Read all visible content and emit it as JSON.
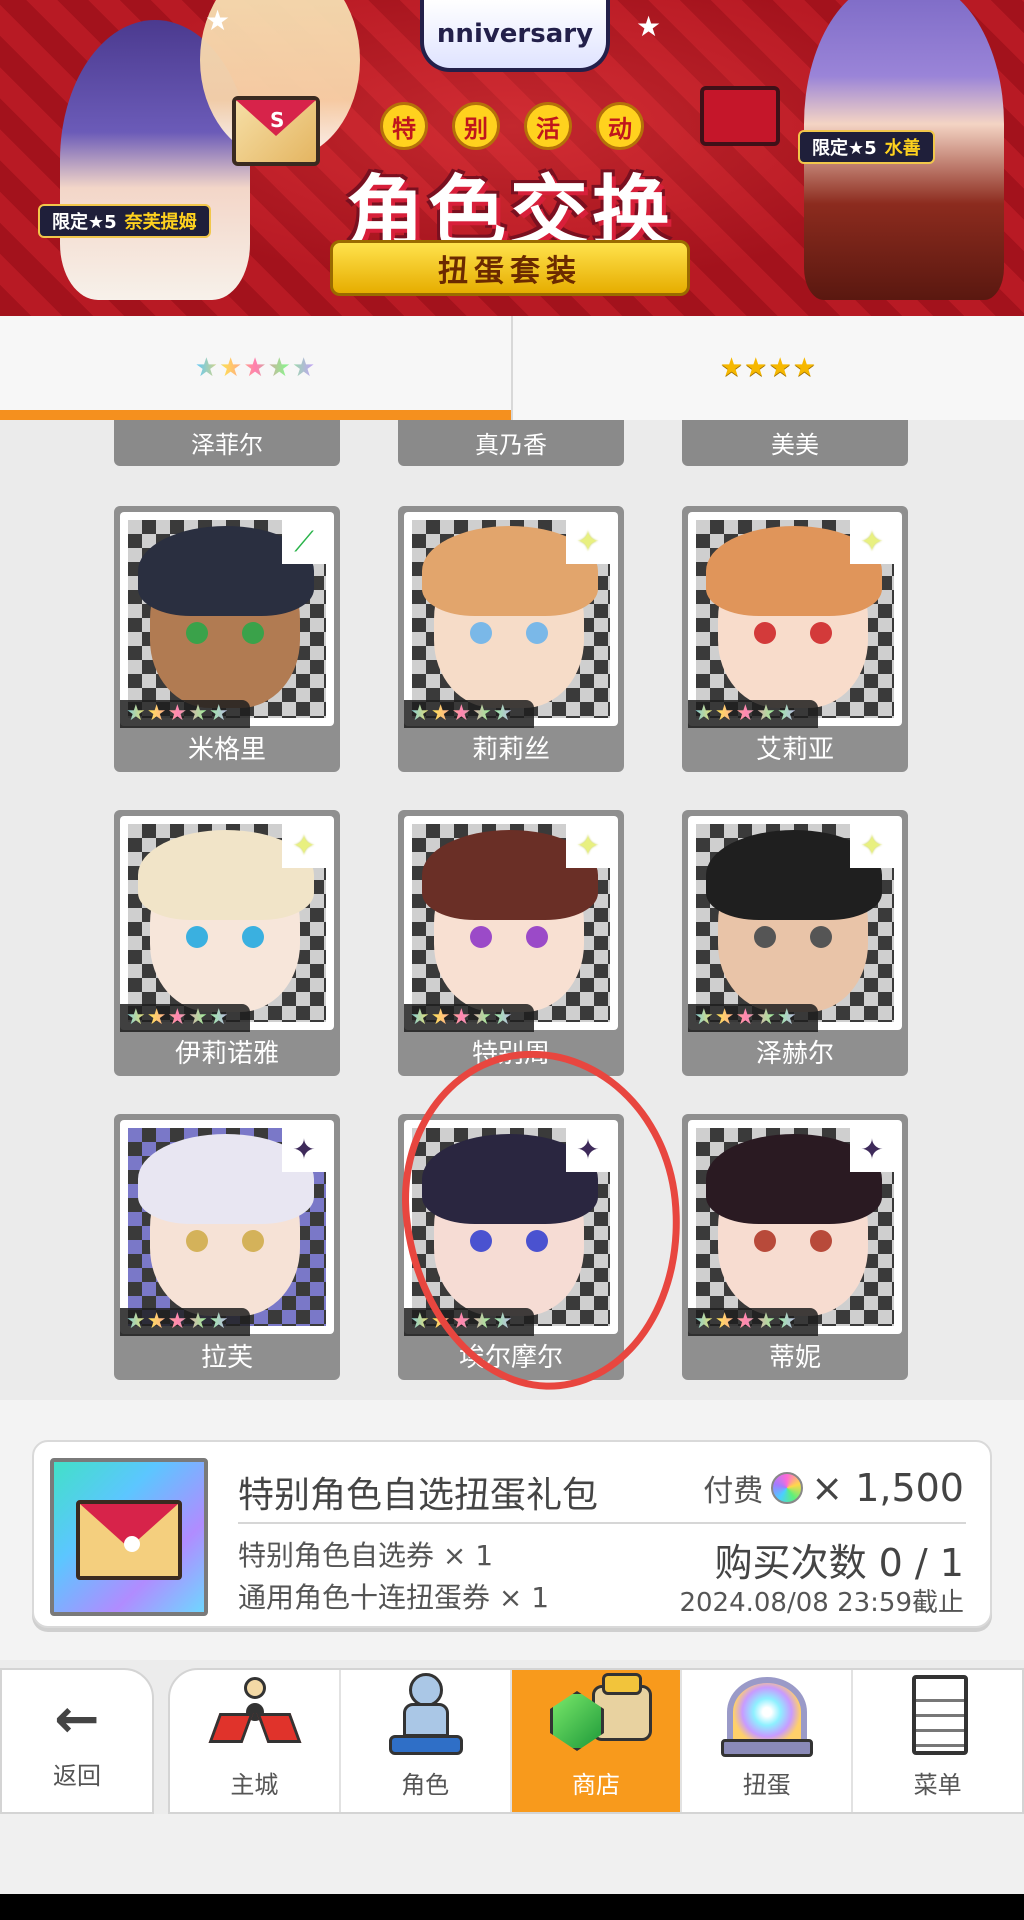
{
  "banner": {
    "logo_text": "nniversary",
    "event_chars": [
      "特",
      "别",
      "活",
      "动"
    ],
    "title": "角色交换",
    "subtitle": "扭蛋套装",
    "tag_left": {
      "prefix": "限定★5",
      "name": "奈芙提姆"
    },
    "tag_right": {
      "prefix": "限定★5",
      "name": "水善"
    }
  },
  "tabs": [
    {
      "label": "★★★★★",
      "active": true
    },
    {
      "label": "★★★★",
      "active": false
    }
  ],
  "partial_row": [
    "泽菲尔",
    "真乃香",
    "美美"
  ],
  "characters": [
    {
      "name": "米格里",
      "stars": "★★★★★",
      "corner": "green",
      "corner_glyph": "⟋"
    },
    {
      "name": "莉莉丝",
      "stars": "★★★★★",
      "corner": "sparkle",
      "corner_glyph": "✦"
    },
    {
      "name": "艾莉亚",
      "stars": "★★★★★",
      "corner": "sparkle",
      "corner_glyph": "✦"
    },
    {
      "name": "伊莉诺雅",
      "stars": "★★★★★",
      "corner": "sparkle",
      "corner_glyph": "✦"
    },
    {
      "name": "特别周",
      "stars": "★★★★★",
      "corner": "sparkle",
      "corner_glyph": "✦"
    },
    {
      "name": "泽赫尔",
      "stars": "★★★★★",
      "corner": "sparkle",
      "corner_glyph": "✦"
    },
    {
      "name": "拉芙",
      "stars": "★★★★★",
      "corner": "dark",
      "corner_glyph": "✦"
    },
    {
      "name": "埃尔摩尔",
      "stars": "★★★★★",
      "corner": "dark",
      "corner_glyph": "✦"
    },
    {
      "name": "蒂妮",
      "stars": "★★★★★",
      "corner": "dark",
      "corner_glyph": "✦"
    }
  ],
  "purchase": {
    "title": "特别角色自选扭蛋礼包",
    "item1": "特别角色自选券 × 1",
    "item2": "通用角色十连扭蛋券 × 1",
    "price_label": "付费",
    "price_amount": "× 1,500",
    "count": "购买次数 0 / 1",
    "deadline": "2024.08/08 23:59截止"
  },
  "nav": {
    "back": "返回",
    "items": [
      {
        "label": "主城",
        "icon": "town-icon"
      },
      {
        "label": "角色",
        "icon": "character-icon"
      },
      {
        "label": "商店",
        "icon": "shop-icon",
        "active": true
      },
      {
        "label": "扭蛋",
        "icon": "gacha-icon"
      },
      {
        "label": "菜单",
        "icon": "menu-icon"
      }
    ]
  },
  "colors": {
    "accent": "#f89a1c",
    "highlight_circle": "#e8463f"
  }
}
